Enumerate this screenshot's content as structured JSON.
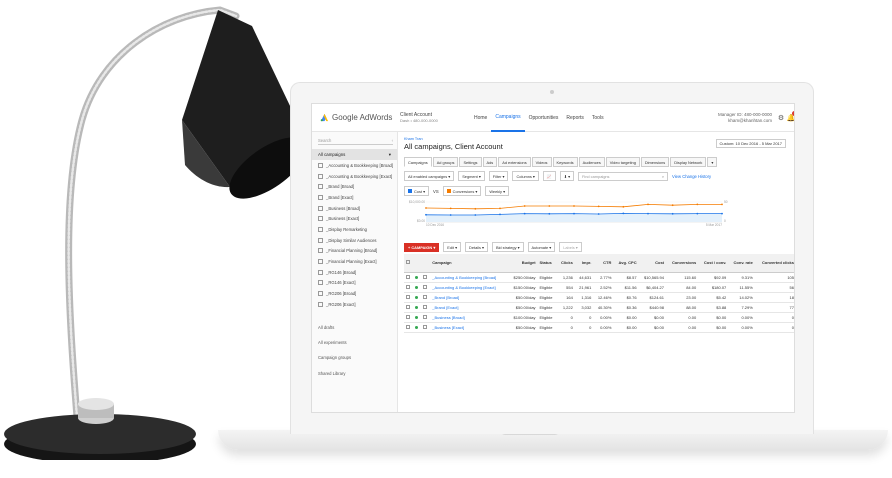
{
  "app": {
    "brand": "Google AdWords",
    "account_name": "Client Account",
    "account_id": "Dash • 480-000-0000"
  },
  "nav": {
    "tabs": [
      "Home",
      "Campaigns",
      "Opportunities",
      "Reports",
      "Tools"
    ]
  },
  "manager": {
    "line1": "Manager ID: 480-000-0000",
    "line2": "kham@khanhtan.com"
  },
  "notifications": {
    "count": "1"
  },
  "sidebar": {
    "search_placeholder": "Search",
    "all_campaigns": "All campaigns",
    "campaigns": [
      "_Accounting & Bookkeeping [Broad]",
      "_Accounting & Bookkeeping [Exact]",
      "_Brand [Broad]",
      "_Brand [Exact]",
      "_Business [Broad]",
      "_Business [Exact]",
      "_Display Remarketing",
      "_Display Similar Audiences",
      "_Financial Planning [Broad]",
      "_Financial Planning [Exact]",
      "_RG146 [Broad]",
      "_RG146 [Exact]",
      "_RG206 [Broad]",
      "_RG206 [Exact]"
    ],
    "links": [
      "All drafts",
      "All experiments",
      "Campaign groups",
      "Shared Library"
    ]
  },
  "main": {
    "breadcrumb": "Kham Tran",
    "title": "All campaigns, Client Account",
    "date_range": "Custom: 10 Dec 2016 - 5 Mar 2017",
    "tabs": [
      "Campaigns",
      "Ad groups",
      "Settings",
      "Ads",
      "Ad extensions",
      "Videos",
      "Keywords",
      "Audiences",
      "Video targeting",
      "Dimensions",
      "Display Network",
      "▾"
    ],
    "filters": {
      "enabled": "All enabled campaigns ▾",
      "segment": "Segment ▾",
      "filter": "Filter ▾",
      "columns": "Columns ▾",
      "search_placeholder": "Find campaigns",
      "history_link": "View Change History"
    },
    "chart_controls": {
      "metric1": "Cost ▾",
      "vs": "VS",
      "metric2": "Conversions ▾",
      "period": "Weekly ▾"
    },
    "actions": {
      "campaign": "+ CAMPAIGN ▾",
      "edit": "Edit ▾",
      "details": "Details ▾",
      "bid": "Bid strategy ▾",
      "automate": "Automate ▾",
      "labels": "Labels ▾"
    },
    "table": {
      "headers": [
        "Campaign",
        "Budget",
        "Status",
        "Clicks",
        "Impr.",
        "CTR",
        "Avg. CPC",
        "Cost",
        "Conversions",
        "Cost / conv.",
        "Conv. rate",
        "Converted clicks"
      ],
      "rows": [
        [
          "_Accounting & Bookkeeping [Broad]",
          "$250.00/day",
          "Eligible",
          "1,236",
          "44,631",
          "2.77%",
          "$8.57",
          "$10,565.94",
          "115.60",
          "$92.09",
          "9.31%",
          "105"
        ],
        [
          "_Accounting & Bookkeeping [Exact]",
          "$150.00/day",
          "Eligible",
          "554",
          "21,961",
          "2.52%",
          "$11.56",
          "$6,404.27",
          "84.00",
          "$180.07",
          "11.55%",
          "56"
        ],
        [
          "_Brand [Broad]",
          "$50.00/day",
          "Eligible",
          "164",
          "1,316",
          "12.46%",
          "$0.76",
          "$124.61",
          "23.00",
          "$5.42",
          "14.02%",
          "18"
        ],
        [
          "_Brand [Exact]",
          "$50.00/day",
          "Eligible",
          "1,222",
          "3,032",
          "40.30%",
          "$0.36",
          "$440.98",
          "88.00",
          "$3.88",
          "7.29%",
          "77"
        ],
        [
          "_Business [Broad]",
          "$100.00/day",
          "Eligible",
          "0",
          "0",
          "0.00%",
          "$0.00",
          "$0.00",
          "0.00",
          "$0.00",
          "0.00%",
          "0"
        ],
        [
          "_Business [Exact]",
          "$50.00/day",
          "Eligible",
          "0",
          "0",
          "0.00%",
          "$0.00",
          "$0.00",
          "0.00",
          "$0.00",
          "0.00%",
          "0"
        ]
      ]
    }
  },
  "chart_data": {
    "type": "line",
    "x": [
      "10 Dec 2016",
      "",
      "",
      "",
      "",
      "",
      "",
      "",
      "",
      "",
      "",
      "",
      "5 Mar 2017"
    ],
    "series": [
      {
        "name": "Cost",
        "color": "#1a73e8",
        "values": [
          3600,
          3500,
          3500,
          3800,
          4200,
          4100,
          4200,
          4000,
          4300,
          4200,
          4100,
          4200,
          4200
        ]
      },
      {
        "name": "Conversions",
        "color": "#f57c00",
        "values": [
          35,
          34,
          33,
          34,
          40,
          40,
          40,
          39,
          38,
          44,
          42,
          44,
          44
        ]
      }
    ],
    "ylabel_left": "$10,000.00",
    "ylabel_left_zero": "$0.00",
    "ylabel_right": "50",
    "ylabel_right_zero": "0"
  },
  "colors": {
    "accent": "#1a73e8",
    "cta": "#d93025",
    "cost": "#1a73e8",
    "conversions": "#f57c00"
  }
}
